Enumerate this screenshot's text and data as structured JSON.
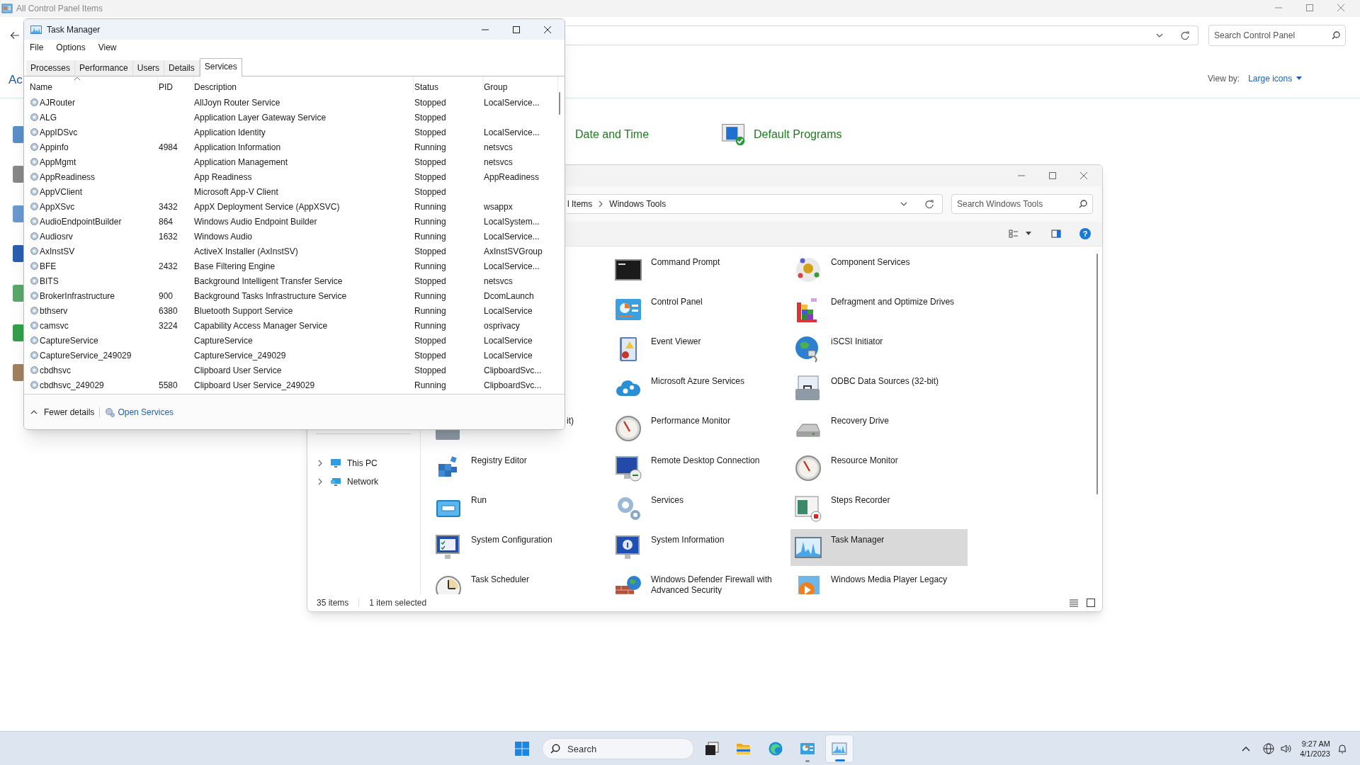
{
  "background_window": {
    "title": "All Control Panel Items",
    "heading": "Ac",
    "search": {
      "placeholder": "Search Control Panel"
    },
    "view_by": {
      "label": "View by:",
      "value": "Large icons"
    },
    "items": [
      {
        "label": "Date and Time",
        "kind": "plain"
      },
      {
        "label": "Default Programs",
        "kind": "default-programs"
      }
    ]
  },
  "windows_tools": {
    "breadcrumb": [
      "l Items",
      "Windows Tools"
    ],
    "search": {
      "placeholder": "Search Windows Tools"
    },
    "help": "?",
    "nav": [
      {
        "label": "This PC",
        "kind": "pc",
        "expanded": false
      },
      {
        "label": "Network",
        "kind": "network",
        "expanded": false
      }
    ],
    "columns": [
      [
        {
          "label": "it)",
          "kind": "toolbox",
          "clipped": true,
          "selected": false
        },
        {
          "label": "Registry Editor",
          "kind": "cubes",
          "clipped": false,
          "selected": false
        },
        {
          "label": "Run",
          "kind": "run",
          "clipped": false,
          "selected": false
        },
        {
          "label": "System Configuration",
          "kind": "monitor-check",
          "clipped": false,
          "selected": false
        },
        {
          "label": "Task Scheduler",
          "kind": "clock",
          "clipped": false,
          "selected": false
        }
      ],
      [
        {
          "label": "Command Prompt",
          "kind": "terminal",
          "clipped": false,
          "selected": false
        },
        {
          "label": "Control Panel",
          "kind": "control-panel",
          "clipped": false,
          "selected": false
        },
        {
          "label": "Event Viewer",
          "kind": "log-book",
          "clipped": false,
          "selected": false
        },
        {
          "label": "Microsoft Azure Services",
          "kind": "cloud-gear",
          "clipped": false,
          "selected": false
        },
        {
          "label": "Performance Monitor",
          "kind": "gauge",
          "clipped": false,
          "selected": false
        },
        {
          "label": "Remote Desktop Connection",
          "kind": "monitor-arrows",
          "clipped": false,
          "selected": false
        },
        {
          "label": "Services",
          "kind": "gears",
          "clipped": false,
          "selected": false
        },
        {
          "label": "System Information",
          "kind": "monitor-info",
          "clipped": false,
          "selected": false
        },
        {
          "label": "Windows Defender Firewall with Advanced Security",
          "kind": "brick-globe",
          "clipped": false,
          "selected": false
        }
      ],
      [
        {
          "label": "Component Services",
          "kind": "atoms",
          "clipped": false,
          "selected": false
        },
        {
          "label": "Defragment and Optimize Drives",
          "kind": "blocks",
          "clipped": false,
          "selected": false
        },
        {
          "label": "iSCSI Initiator",
          "kind": "globe",
          "clipped": false,
          "selected": false
        },
        {
          "label": "ODBC Data Sources (32-bit)",
          "kind": "toolbox",
          "clipped": false,
          "selected": false
        },
        {
          "label": "Recovery Drive",
          "kind": "drive",
          "clipped": false,
          "selected": false
        },
        {
          "label": "Resource Monitor",
          "kind": "gauge",
          "clipped": false,
          "selected": false
        },
        {
          "label": "Steps Recorder",
          "kind": "recorder",
          "clipped": false,
          "selected": false
        },
        {
          "label": "Task Manager",
          "kind": "chart",
          "clipped": false,
          "selected": true
        },
        {
          "label": "Windows Media Player Legacy",
          "kind": "play",
          "clipped": false,
          "selected": false
        }
      ]
    ],
    "status": [
      "35 items",
      "1 item selected"
    ]
  },
  "task_manager": {
    "title": "Task Manager",
    "menu": [
      "File",
      "Options",
      "View"
    ],
    "tabs": [
      {
        "label": "Processes",
        "selected": false
      },
      {
        "label": "Performance",
        "selected": false
      },
      {
        "label": "Users",
        "selected": false
      },
      {
        "label": "Details",
        "selected": false
      },
      {
        "label": "Services",
        "selected": true
      }
    ],
    "columns": [
      {
        "label": "Name",
        "sorted": true
      },
      {
        "label": "PID",
        "sorted": false
      },
      {
        "label": "Description",
        "sorted": false
      },
      {
        "label": "Status",
        "sorted": false
      },
      {
        "label": "Group",
        "sorted": false
      }
    ],
    "rows": [
      [
        "AJRouter",
        "",
        "AllJoyn Router Service",
        "Stopped",
        "LocalService..."
      ],
      [
        "ALG",
        "",
        "Application Layer Gateway Service",
        "Stopped",
        ""
      ],
      [
        "AppIDSvc",
        "",
        "Application Identity",
        "Stopped",
        "LocalService..."
      ],
      [
        "Appinfo",
        "4984",
        "Application Information",
        "Running",
        "netsvcs"
      ],
      [
        "AppMgmt",
        "",
        "Application Management",
        "Stopped",
        "netsvcs"
      ],
      [
        "AppReadiness",
        "",
        "App Readiness",
        "Stopped",
        "AppReadiness"
      ],
      [
        "AppVClient",
        "",
        "Microsoft App-V Client",
        "Stopped",
        ""
      ],
      [
        "AppXSvc",
        "3432",
        "AppX Deployment Service (AppXSVC)",
        "Running",
        "wsappx"
      ],
      [
        "AudioEndpointBuilder",
        "864",
        "Windows Audio Endpoint Builder",
        "Running",
        "LocalSystem..."
      ],
      [
        "Audiosrv",
        "1632",
        "Windows Audio",
        "Running",
        "LocalService..."
      ],
      [
        "AxInstSV",
        "",
        "ActiveX Installer (AxInstSV)",
        "Stopped",
        "AxInstSVGroup"
      ],
      [
        "BFE",
        "2432",
        "Base Filtering Engine",
        "Running",
        "LocalService..."
      ],
      [
        "BITS",
        "",
        "Background Intelligent Transfer Service",
        "Stopped",
        "netsvcs"
      ],
      [
        "BrokerInfrastructure",
        "900",
        "Background Tasks Infrastructure Service",
        "Running",
        "DcomLaunch"
      ],
      [
        "bthserv",
        "6380",
        "Bluetooth Support Service",
        "Running",
        "LocalService"
      ],
      [
        "camsvc",
        "3224",
        "Capability Access Manager Service",
        "Running",
        "osprivacy"
      ],
      [
        "CaptureService",
        "",
        "CaptureService",
        "Stopped",
        "LocalService"
      ],
      [
        "CaptureService_249029",
        "",
        "CaptureService_249029",
        "Stopped",
        "LocalService"
      ],
      [
        "cbdhsvc",
        "",
        "Clipboard User Service",
        "Stopped",
        "ClipboardSvc..."
      ],
      [
        "cbdhsvc_249029",
        "5580",
        "Clipboard User Service_249029",
        "Running",
        "ClipboardSvc..."
      ]
    ],
    "footer": {
      "fewer_details": "Fewer details",
      "open_services": "Open Services"
    }
  },
  "taskbar": {
    "search": {
      "placeholder": "Search"
    },
    "apps": [
      {
        "kind": "task-view",
        "running": false,
        "active": false
      },
      {
        "kind": "folder",
        "running": false,
        "active": false
      },
      {
        "kind": "browser",
        "running": false,
        "active": false
      },
      {
        "kind": "control-panel",
        "running": true,
        "active": false
      },
      {
        "kind": "chart",
        "running": true,
        "active": true
      }
    ],
    "clock": {
      "time": "9:27 AM",
      "date": "4/1/2023"
    }
  }
}
